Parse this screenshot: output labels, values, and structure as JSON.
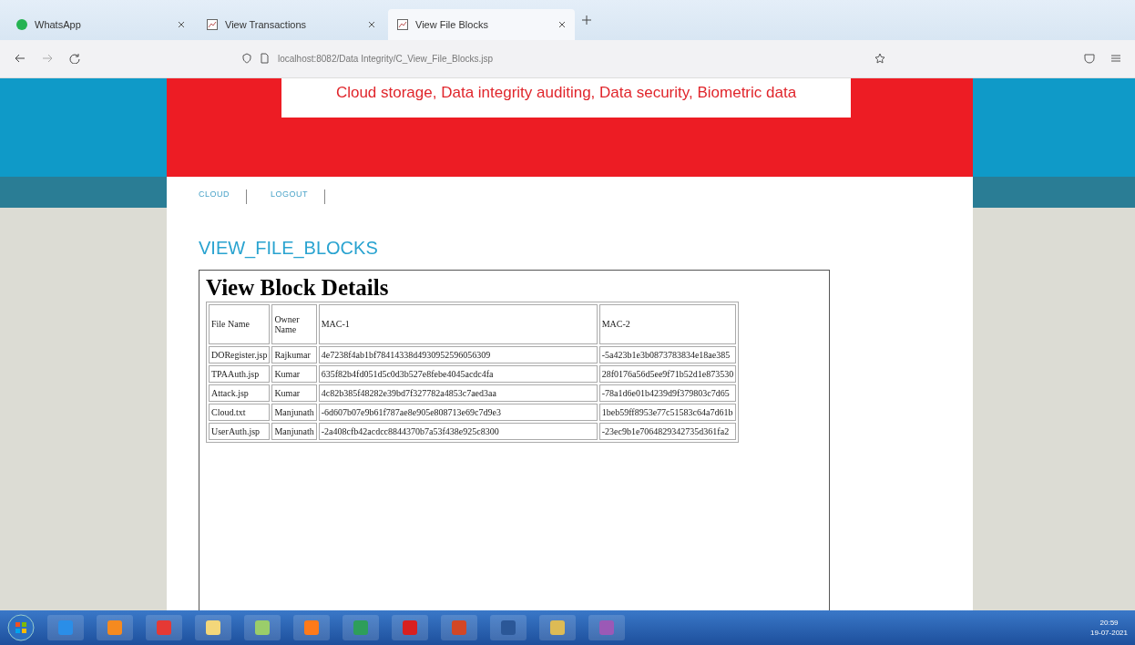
{
  "browser": {
    "tabs": [
      {
        "title": "WhatsApp",
        "kind": "whatsapp",
        "selected": false
      },
      {
        "title": "View Transactions",
        "kind": "page",
        "selected": false
      },
      {
        "title": "View File Blocks",
        "kind": "page",
        "selected": true
      }
    ],
    "url": "localhost:8082/Data Integrity/C_View_File_Blocks.jsp"
  },
  "page": {
    "banner": "Cloud storage, Data integrity auditing, Data security, Biometric data",
    "nav": [
      "CLOUD",
      "LOGOUT"
    ],
    "heading": "VIEW_FILE_BLOCKS",
    "table_title": "View Block Details",
    "table": {
      "columns": [
        "File Name",
        "Owner Name",
        "MAC-1",
        "MAC-2"
      ],
      "rows": [
        [
          "DORegister.jsp",
          "Rajkumar",
          "4e7238f4ab1bf78414338d4930952596056309",
          "-5a423b1e3b0873783834e18ae385"
        ],
        [
          "TPAAuth.jsp",
          "Kumar",
          "635f82b4fd051d5c0d3b527e8febe4045acdc4fa",
          "28f0176a56d5ee9f71b52d1e873530"
        ],
        [
          "Attack.jsp",
          "Kumar",
          "4c82b385f48282e39bd7f327782a4853c7aed3aa",
          "-78a1d6e01b4239d9f379803c7d65"
        ],
        [
          "Cloud.txt",
          "Manjunath",
          "-6d607b07e9b61f787ae8e905e808713e69c7d9e3",
          "1beb59ff8953e77c51583c64a7d61b"
        ],
        [
          "UserAuth.jsp",
          "Manjunath",
          "-2a408cfb42acdcc8844370b7a53f438e925c8300",
          "-23ec9b1e7064829342735d361fa2"
        ]
      ]
    }
  },
  "taskbar": {
    "time": "20:59",
    "date": "19-07-2021"
  }
}
